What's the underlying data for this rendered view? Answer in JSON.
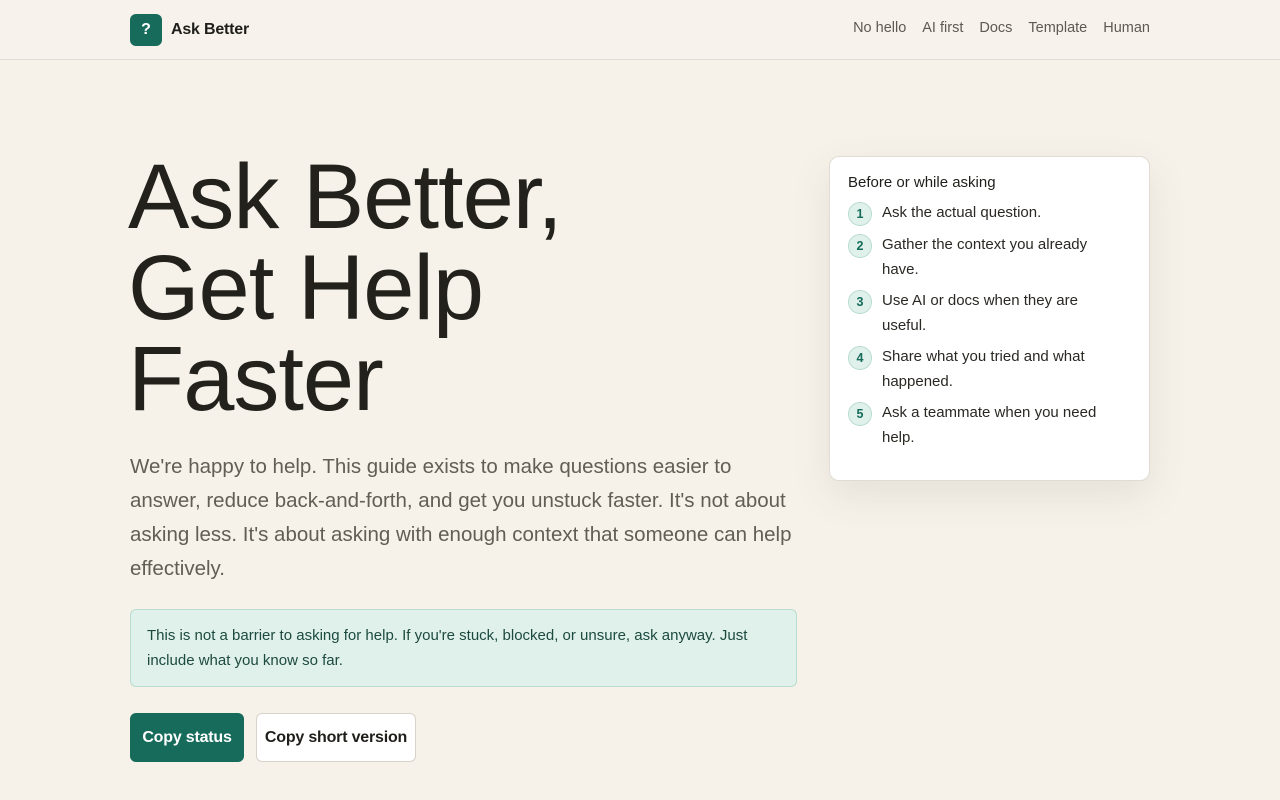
{
  "header": {
    "logo_glyph": "?",
    "brand_name": "Ask Better",
    "nav": [
      "No hello",
      "AI first",
      "Docs",
      "Template",
      "Human"
    ]
  },
  "hero": {
    "title_lines": [
      "Ask Better,",
      "Get Help",
      "Faster"
    ],
    "lede": "We're happy to help. This guide exists to make questions easier to answer, reduce back-and-forth, and get you unstuck faster. It's not about asking less. It's about asking with enough context that someone can help effectively.",
    "notice": "This is not a barrier to asking for help. If you're stuck, blocked, or unsure, ask anyway. Just include what you know so far.",
    "primary_button": "Copy status",
    "secondary_button": "Copy short version"
  },
  "card": {
    "title": "Before or while asking",
    "steps": [
      {
        "num": "1",
        "text": "Ask the actual question."
      },
      {
        "num": "2",
        "text": "Gather the context you already have."
      },
      {
        "num": "3",
        "text": "Use AI or docs when they are useful."
      },
      {
        "num": "4",
        "text": "Share what you tried and what happened."
      },
      {
        "num": "5",
        "text": "Ask a teammate when you need help."
      }
    ]
  },
  "colors": {
    "accent": "#176b5b",
    "background": "#f6f2ea",
    "notice_bg": "#dff1ea"
  }
}
